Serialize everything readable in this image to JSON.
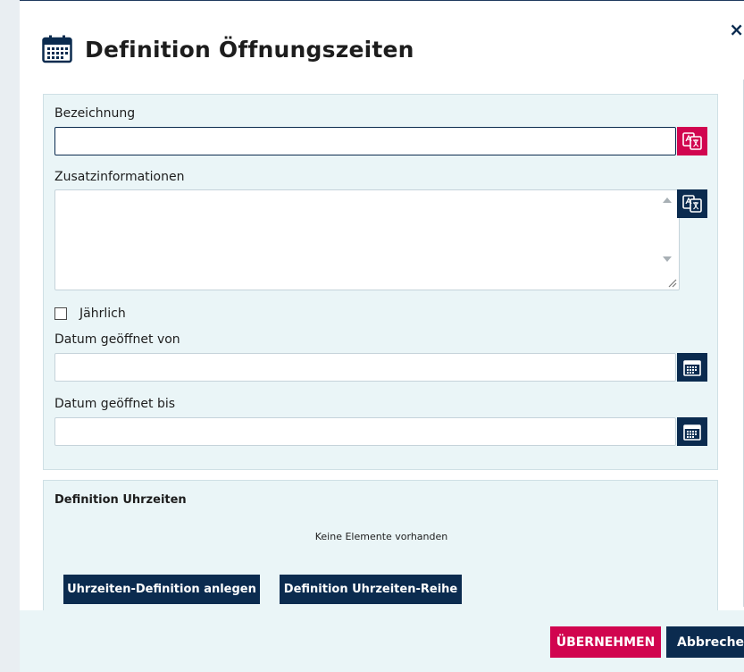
{
  "dialog": {
    "title": "Definition Öffnungszeiten",
    "close_label": "×"
  },
  "form": {
    "bezeichnung_label": "Bezeichnung",
    "bezeichnung_value": "",
    "zusatz_label": "Zusatzinformationen",
    "zusatz_value": "",
    "jaehrlich_label": "Jährlich",
    "jaehrlich_checked": false,
    "datum_von_label": "Datum geöffnet von",
    "datum_von_value": "",
    "datum_bis_label": "Datum geöffnet bis",
    "datum_bis_value": ""
  },
  "uhrzeiten": {
    "title": "Definition Uhrzeiten",
    "empty_text": "Keine Elemente vorhanden",
    "add_button": "Uhrzeiten-Definition anlegen",
    "series_button": "Definition Uhrzeiten-Reihe"
  },
  "footer": {
    "apply_label": "ÜBERNEHMEN",
    "cancel_label": "Abbrechen"
  },
  "colors": {
    "accent_pink": "#d1054f",
    "navy": "#0b2b4f",
    "panel_bg": "#eaf5f7"
  },
  "icons": {
    "title": "calendar-icon",
    "translate": "translate-icon",
    "date": "calendar-icon"
  }
}
